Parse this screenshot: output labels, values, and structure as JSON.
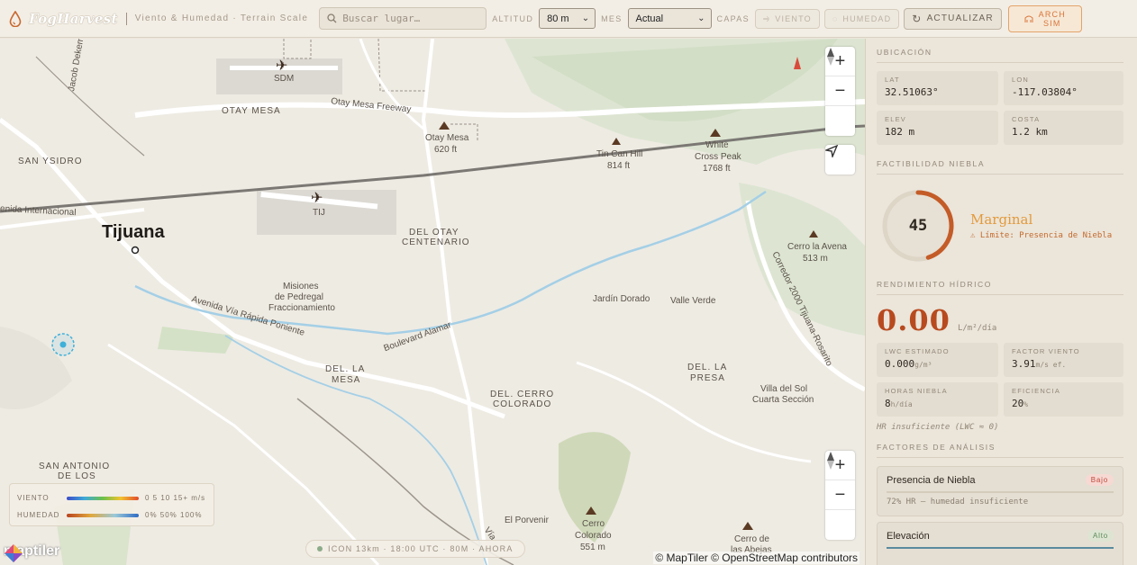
{
  "header": {
    "brand": "FogHarvest",
    "subtitle": "Viento & Humedad · Terrain Scale",
    "search_placeholder": "Buscar lugar…",
    "altitude_label": "ALTITUD",
    "altitude_value": "80 m",
    "month_label": "MES",
    "month_value": "Actual",
    "layers_label": "CAPAS",
    "layer_wind": "VIENTO",
    "layer_humidity": "HUMEDAD",
    "refresh": "ACTUALIZAR",
    "arch_line1": "ARCH",
    "arch_line2": "SIM"
  },
  "map": {
    "labels": {
      "otay_mesa": "OTAY MESA",
      "otay_fwy": "Otay Mesa Freeway",
      "otay_mesa_peak": "Otay Mesa",
      "otay_mesa_peak_ft": "620 ft",
      "tin_can": "Tin Can Hill",
      "tin_can_ft": "814 ft",
      "white_cross": "White",
      "white_cross2": "Cross Peak",
      "white_cross_ft": "1768 ft",
      "sdm": "SDM",
      "tij": "TIJ",
      "san_ysidro": "SAN YSIDRO",
      "internacional": "enida Internacional",
      "tijuana": "Tijuana",
      "del_otay": "DEL OTAY",
      "centenario": "CENTENARIO",
      "cerro_avena": "Cerro la Avena",
      "cerro_avena_m": "513 m",
      "misiones1": "Misiones",
      "misiones2": "de Pedregal",
      "misiones3": "Fraccionamiento",
      "jardin": "Jardín Dorado",
      "valle_verde": "Valle Verde",
      "via_rapida": "Avenida Vía Rápida Poniente",
      "alamar": "Boulevard Alamar",
      "corredor": "Corredor 2000 Tijuana-Rosarito",
      "del_la_mesa1": "DEL. LA",
      "del_la_mesa2": "MESA",
      "del_la_presa1": "DEL. LA",
      "del_la_presa2": "PRESA",
      "villa_sol1": "Villa del Sol",
      "villa_sol2": "Cuarta Sección",
      "cerro_col1": "DEL. CERRO",
      "cerro_col2": "COLORADO",
      "san_antonio1": "SAN ANTONIO",
      "san_antonio2": "DE LOS",
      "porvenir": "El Porvenir",
      "cerro_colorado1": "Cerro",
      "cerro_colorado2": "Colorado",
      "cerro_colorado_m": "551 m",
      "abejas1": "Cerro de",
      "abejas2": "las Abejas",
      "jacob": "Jacob Dekema",
      "via": "Vía"
    },
    "legend": {
      "wind_label": "VIENTO",
      "wind_scale": "0 5 10 15+ m/s",
      "hum_label": "HUMEDAD",
      "hum_scale": "0% 50% 100%"
    },
    "status": "ICON 13km · 18:00 UTC · 80M · AHORA",
    "attribution": "© MapTiler © OpenStreetMap contributors",
    "maptiler": "maptiler"
  },
  "sidebar": {
    "location_title": "UBICACIÓN",
    "lat_label": "LAT",
    "lat": "32.51063°",
    "lon_label": "LON",
    "lon": "-117.03804°",
    "elev_label": "ELEV",
    "elev": "182 m",
    "coast_label": "COSTA",
    "coast": "1.2 km",
    "fog_title": "FACTIBILIDAD NIEBLA",
    "score": "45",
    "score_value": 45,
    "rating": "Marginal",
    "limit": "⚠ Límite: Presencia de Niebla",
    "yield_title": "RENDIMIENTO HÍDRICO",
    "yield_value": "0.00",
    "yield_unit": "L/m²/día",
    "lwc_label": "LWC ESTIMADO",
    "lwc": "0.000",
    "lwc_unit": "g/m³",
    "wind_factor_label": "FACTOR VIENTO",
    "wind_factor": "3.91",
    "wind_factor_unit": "m/s ef.",
    "fog_hours_label": "HORAS NIEBLA",
    "fog_hours": "8",
    "fog_hours_unit": "h/día",
    "eff_label": "EFICIENCIA",
    "eff": "20",
    "eff_unit": "%",
    "note": "HR insuficiente (LWC ≈ 0)",
    "factors_title": "FACTORES DE ANÁLISIS",
    "factors": [
      {
        "name": "Presencia de Niebla",
        "badge": "Bajo",
        "desc": "72% HR — humedad insuficiente",
        "level": 0.0
      },
      {
        "name": "Elevación",
        "badge": "Alto",
        "desc": "",
        "level": 1.0
      }
    ]
  },
  "colors": {
    "accent": "#e39a3c",
    "danger": "#b84a1f",
    "gauge": "#c45c28"
  }
}
